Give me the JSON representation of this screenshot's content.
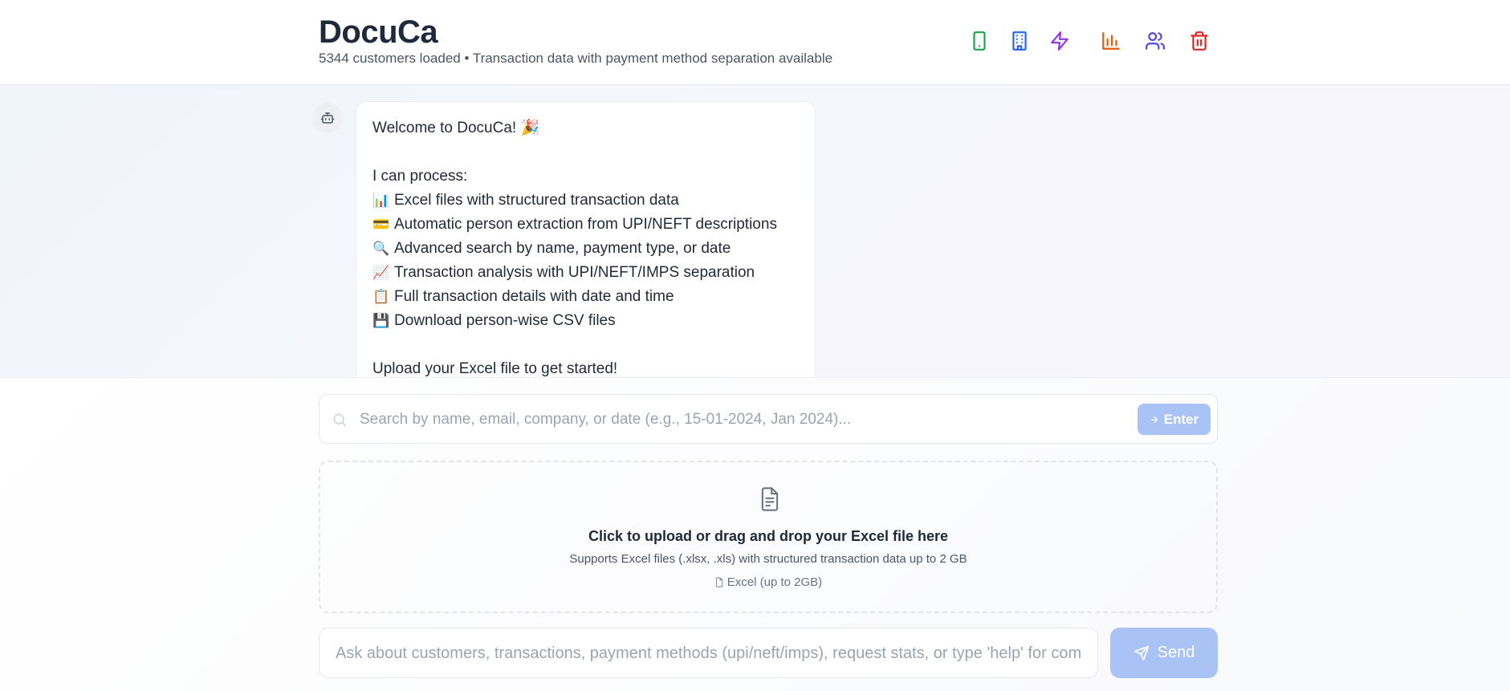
{
  "header": {
    "title": "DocuCa",
    "subtitle": "5344 customers loaded • Transaction data with payment method separation available",
    "icons": [
      {
        "name": "smartphone-icon",
        "color": "#16a34a"
      },
      {
        "name": "building-icon",
        "color": "#2563eb"
      },
      {
        "name": "zap-icon",
        "color": "#9333ea"
      },
      {
        "name": "bar-chart-icon",
        "color": "#ea580c"
      },
      {
        "name": "users-icon",
        "color": "#4f46e5"
      },
      {
        "name": "trash-icon",
        "color": "#dc2626"
      }
    ]
  },
  "chat": {
    "bot_icon": "bot-icon",
    "welcome": "Welcome to DocuCa! 🎉",
    "intro": "I can process:",
    "features": [
      {
        "emoji": "📊",
        "text": "Excel files with structured transaction data"
      },
      {
        "emoji": "💳",
        "text": "Automatic person extraction from UPI/NEFT descriptions"
      },
      {
        "emoji": "🔍",
        "text": "Advanced search by name, payment type, or date"
      },
      {
        "emoji": "📈",
        "text": "Transaction analysis with UPI/NEFT/IMPS separation"
      },
      {
        "emoji": "📋",
        "text": "Full transaction details with date and time"
      },
      {
        "emoji": "💾",
        "text": "Download person-wise CSV files"
      }
    ],
    "outro": "Upload your Excel file to get started!"
  },
  "search": {
    "placeholder": "Search by name, email, company, or date (e.g., 15-01-2024, Jan 2024)...",
    "button_label": "Enter"
  },
  "upload": {
    "title": "Click to upload or drag and drop your Excel file here",
    "subtitle": "Supports Excel files (.xlsx, .xls) with structured transaction data up to 2 GB",
    "badge": "Excel (up to 2GB)"
  },
  "composer": {
    "placeholder": "Ask about customers, transactions, payment methods (upi/neft/imps), request stats, or type 'help' for commands",
    "send_label": "Send"
  },
  "colors": {
    "accent_disabled": "#a9c3f6",
    "title": "#1e293b"
  }
}
